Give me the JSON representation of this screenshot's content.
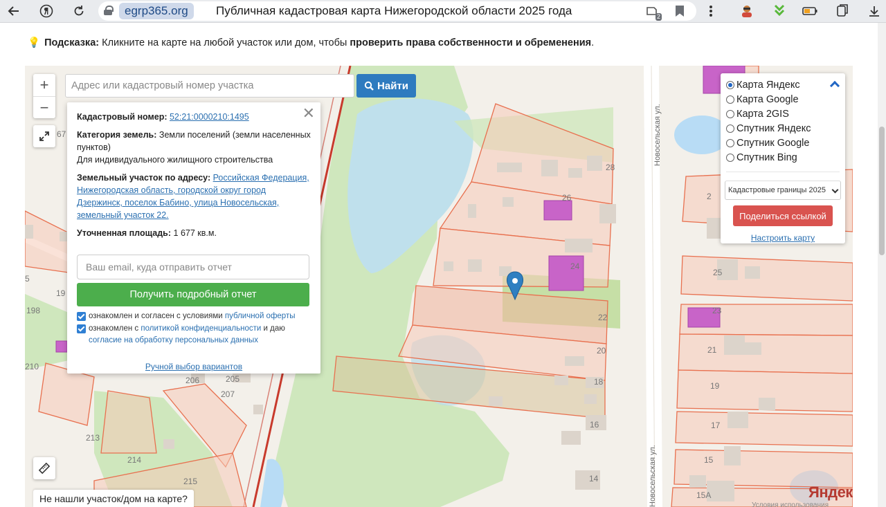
{
  "browser": {
    "domain": "egrp365.org",
    "tab_title": "Публичная кадастровая карта Нижегородской области 2025 года",
    "extension_badge_count": "2",
    "icons": [
      "back-arrow-icon",
      "yandex-logo-icon",
      "reload-icon",
      "lock-icon",
      "extension-icon",
      "bookmark-icon",
      "menu-dots-icon",
      "profile-icon",
      "download-arrow-icon",
      "battery-icon",
      "tabs-icon",
      "downloads-icon"
    ]
  },
  "hint": {
    "label": "Подсказка:",
    "text": "Кликните на карте на любой участок или дом, чтобы",
    "emphasis": "проверить права собственности и обременения",
    "tail": "."
  },
  "search": {
    "placeholder": "Адрес или кадастровый номер участка",
    "button_label": "Найти"
  },
  "zoom": {
    "plus": "+",
    "minus": "−"
  },
  "popup": {
    "cadastral_label": "Кадастровый номер:",
    "cadastral_number": "52:21:0000210:1495",
    "category_label": "Категория земель:",
    "category_value": "Земли поселений (земли населенных пунктов)",
    "use": "Для индивидуального жилищного строительства",
    "address_label": "Земельный участок по адресу:",
    "address_value": "Российская Федерация, Нижегородская область, городской округ город Дзержинск, поселок Бабино, улица Новосельская, земельный участок 22.",
    "area_label": "Уточненная площадь:",
    "area_value": "1 677 кв.м.",
    "email_placeholder": "Ваш email, куда отправить отчет",
    "report_button": "Получить подробный отчет",
    "consent1_text": "ознакомлен и согласен с условиями",
    "consent1_link": "публичной оферты",
    "consent2_text": "ознакомлен с",
    "consent2_link": "политикой конфиденциальности",
    "consent2_mid": "и даю",
    "consent2_link2": "согласие на обработку персональных данных",
    "manual_link": "Ручной выбор вариантов"
  },
  "layers": {
    "options": [
      {
        "label": "Карта Яндекс",
        "selected": true
      },
      {
        "label": "Карта Google",
        "selected": false
      },
      {
        "label": "Карта 2GIS",
        "selected": false
      },
      {
        "label": "Спутник Яндекс",
        "selected": false
      },
      {
        "label": "Спутник Google",
        "selected": false
      },
      {
        "label": "Спутник Bing",
        "selected": false
      }
    ],
    "overlay_select": "Кадастровые границы 2025",
    "share_button": "Поделиться ссылкой",
    "setup_link": "Настроить карту"
  },
  "map": {
    "street_name": "Новосельская ул.",
    "house_numbers": [
      "28",
      "26",
      "24",
      "22",
      "20",
      "18",
      "16",
      "14",
      "25",
      "23",
      "21",
      "19",
      "17",
      "15",
      "15А",
      "206",
      "205",
      "207",
      "210",
      "213",
      "214",
      "215",
      "198",
      "19",
      "67",
      "5",
      "2"
    ],
    "not_found": "Не нашли участок/дом на карте?",
    "provider_logo": "Яндекс",
    "provider_terms": "Условия использования",
    "colors": {
      "parcel_fill": "#f5c9b8",
      "parcel_border": "#e8704f",
      "highlight_fill": "#c864c8",
      "green": "#c9e6b3",
      "water": "#b8dcf5",
      "road_red": "#c83a2c",
      "marker": "#2f7fc1"
    }
  }
}
